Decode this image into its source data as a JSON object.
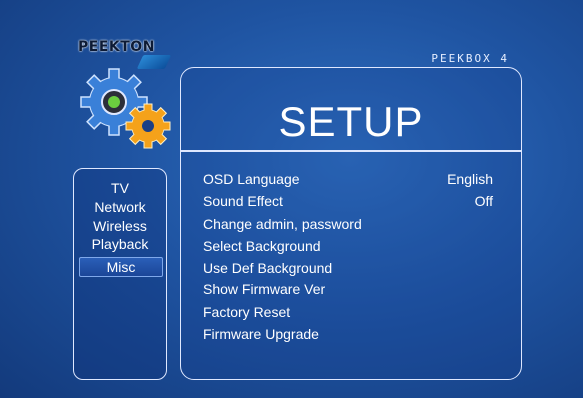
{
  "brand": {
    "name": "PEEKTON",
    "model": "PEEKBOX 4"
  },
  "panel_title": "SETUP",
  "sidebar": {
    "items": [
      {
        "label": "TV",
        "active": false
      },
      {
        "label": "Network",
        "active": false
      },
      {
        "label": "Wireless",
        "active": false
      },
      {
        "label": "Playback",
        "active": false
      },
      {
        "label": "Misc",
        "active": true
      }
    ]
  },
  "settings": [
    {
      "label": "OSD Language",
      "value": "English"
    },
    {
      "label": "Sound Effect",
      "value": "Off"
    },
    {
      "label": "Change admin, password",
      "value": ""
    },
    {
      "label": "Select Background",
      "value": ""
    },
    {
      "label": "Use Def Background",
      "value": ""
    },
    {
      "label": "Show Firmware Ver",
      "value": ""
    },
    {
      "label": "Factory Reset",
      "value": ""
    },
    {
      "label": "Firmware Upgrade",
      "value": ""
    }
  ],
  "colors": {
    "accent": "#2a5fb8",
    "border": "#dfe8ff",
    "gear_blue": "#3a80d8",
    "gear_orange": "#f5a21a"
  }
}
